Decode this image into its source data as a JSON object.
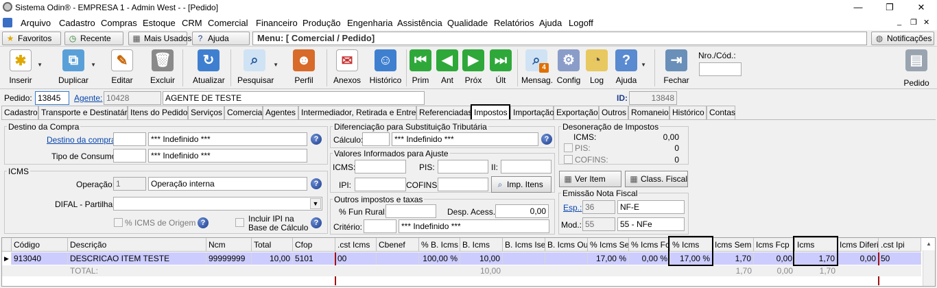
{
  "window": {
    "title": "Sistema Odin® - EMPRESA 1 - Admin West -  - [Pedido]",
    "minimize": "—",
    "restore": "❐",
    "close": "✕"
  },
  "menu": [
    "Arquivo",
    "Cadastro",
    "Compras",
    "Estoque",
    "CRM",
    "Comercial",
    "Financeiro",
    "Produção",
    "Engenharia",
    "Assistência",
    "Qualidade",
    "Relatórios",
    "Ajuda",
    "Logoff"
  ],
  "mdi_controls": [
    "_",
    "❐",
    "✕"
  ],
  "favbar": {
    "favoritos": "Favoritos",
    "recente": "Recente",
    "mais_usados": "Mais Usados",
    "ajuda": "Ajuda",
    "menu_path": "Menu: [ Comercial / Pedido]",
    "notificacoes": "Notificações"
  },
  "toolbar": {
    "inserir": "Inserir",
    "duplicar": "Duplicar",
    "editar": "Editar",
    "excluir": "Excluir",
    "atualizar": "Atualizar",
    "pesquisar": "Pesquisar",
    "perfil": "Perfil",
    "anexos": "Anexos",
    "historico": "Histórico",
    "prim": "Prim",
    "ant": "Ant",
    "prox": "Próx",
    "ult": "Últ",
    "mensag": "Mensag.",
    "mensag_badge": "4",
    "config": "Config",
    "log": "Log",
    "ajuda": "Ajuda",
    "fechar": "Fechar",
    "nro_cod_label": "Nro./Cód.:",
    "nro_cod_value": "",
    "pedido": "Pedido"
  },
  "header": {
    "pedido_label": "Pedido:",
    "pedido_value": "13845",
    "agente_label": "Agente:",
    "agente_code": "10428",
    "agente_name": "AGENTE DE TESTE",
    "id_label": "ID:",
    "id_value": "13848"
  },
  "tabs": [
    "Cadastro",
    "Transporte e Destinatário",
    "Itens do Pedido",
    "Serviços",
    "Comercial",
    "Agentes",
    "Intermediador, Retirada e Entrega",
    "Referenciadas",
    "Impostos",
    "Importação",
    "Exportação",
    "Outros",
    "Romaneio",
    "Histórico",
    "Contas"
  ],
  "active_tab": "Impostos",
  "destino": {
    "title": "Destino da Compra",
    "destino_label": "Destino da compra:",
    "destino_code": "",
    "destino_value": "*** Indefinido ***",
    "tipo_label": "Tipo de Consumo:",
    "tipo_code": "",
    "tipo_value": "*** Indefinido ***"
  },
  "icms_group": {
    "title": "ICMS",
    "operacao_label": "Operação:",
    "operacao_code": "1",
    "operacao_value": "Operação interna",
    "difal_label": "DIFAL - Partilha:",
    "difal_value": "",
    "pct_origem_label": "% ICMS de Origem",
    "incluir_ipi_label_1": "Incluir IPI na",
    "incluir_ipi_label_2": "Base de Cálculo"
  },
  "difst": {
    "title": "Diferenciação para Substituição Tributária",
    "calculo_label": "Cálculo:",
    "calculo_code": "",
    "calculo_value": "*** Indefinido ***"
  },
  "valores": {
    "title": "Valores Informados para Ajuste",
    "icms_label": "ICMS:",
    "pis_label": "PIS:",
    "ii_label": "II:",
    "ipi_label": "IPI:",
    "cofins_label": "COFINS:",
    "imp_itens": "Imp. Itens"
  },
  "outros": {
    "title": "Outros impostos e taxas",
    "fun_rural_label": "% Fun Rural:",
    "fun_rural_value": "",
    "desp_label": "Desp. Acess.:",
    "desp_value": "0,00",
    "criterio_label": "Critério:",
    "criterio_code": "",
    "criterio_value": "*** Indefinido ***"
  },
  "desoneracao": {
    "title": "Desoneração de Impostos",
    "icms_label": "ICMS:",
    "icms_value": "0,00",
    "pis_label": "PIS:",
    "pis_value": "0",
    "cofins_label": "COFINS:",
    "cofins_value": "0"
  },
  "buttons": {
    "ver_item": "Ver Item",
    "class_fiscal": "Class. Fiscal"
  },
  "emissao": {
    "title": "Emissão Nota Fiscal",
    "esp_label": "Esp.:",
    "esp_code": "36",
    "esp_value": "NF-E",
    "mod_label": "Mod.:",
    "mod_code": "55",
    "mod_value": "55 - NFe"
  },
  "grid": {
    "columns": [
      "Código",
      "Descrição",
      "Ncm",
      "Total",
      "Cfop",
      ".cst Icms",
      "Cbenef",
      "% B. Icms",
      "B. Icms",
      "B. Icms Isen",
      "B. Icms Outr",
      "% Icms Sem",
      "% Icms Fcp",
      "% Icms",
      "Icms Sem Fc",
      "Icms Fcp",
      "Icms",
      "Icms Diferido",
      ".cst Ipi"
    ],
    "row": [
      "913040",
      "DESCRICAO ITEM TESTE",
      "99999999",
      "10,00",
      "5101",
      "00",
      "",
      "100,00 %",
      "10,00",
      "",
      "",
      "17,00 %",
      "0,00 %",
      "17,00 %",
      "1,70",
      "0,00",
      "1,70",
      "0,00",
      "50"
    ],
    "total_label": "TOTAL:",
    "total_b_icms": "10,00",
    "total_icms_sem_fcp": "1,70",
    "total_icms_fcp": "0,00",
    "total_icms": "1,70"
  }
}
